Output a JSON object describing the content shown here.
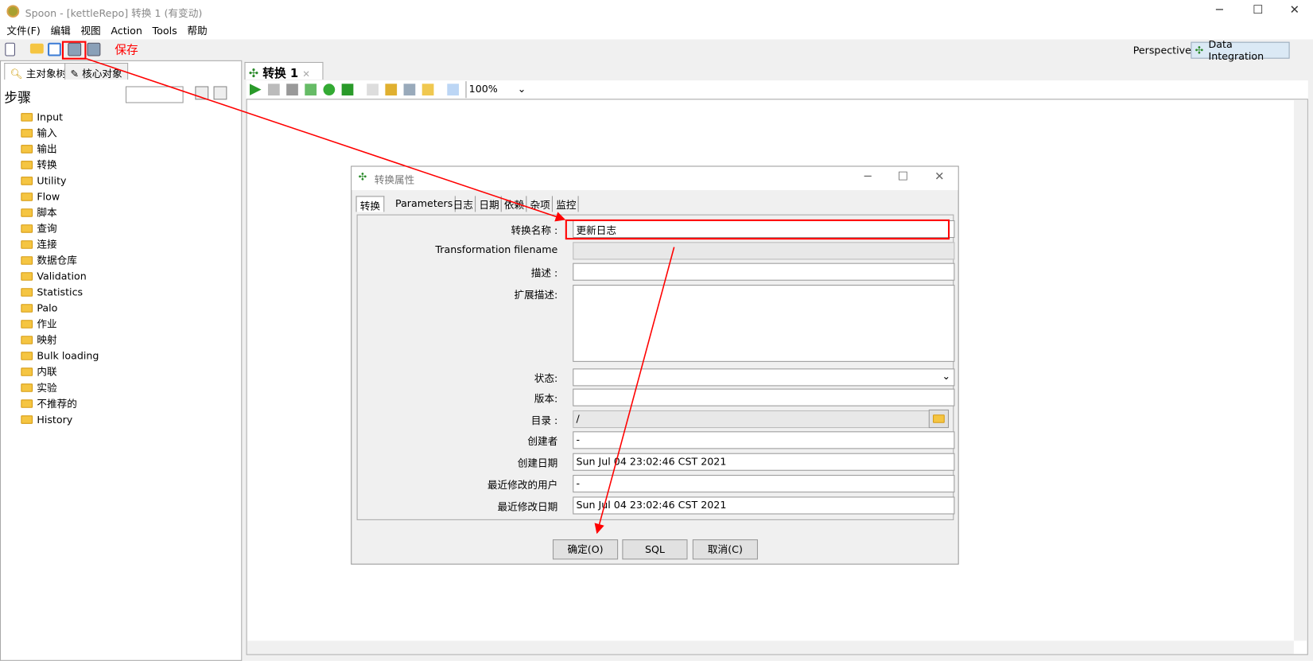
{
  "window": {
    "title": "Spoon - [kettleRepo] 转换 1 (有变动)"
  },
  "menu": [
    "文件(F)",
    "编辑",
    "视图",
    "Action",
    "Tools",
    "帮助"
  ],
  "annotation": {
    "save_label": "保存",
    "color": "#ff0000"
  },
  "perspective": {
    "label": "Perspective:",
    "value": "Data Integration"
  },
  "left_tabs": [
    "主对象树",
    "核心对象"
  ],
  "steps_label": "步骤",
  "steps": [
    "Input",
    "输入",
    "输出",
    "转换",
    "Utility",
    "Flow",
    "脚本",
    "查询",
    "连接",
    "数据仓库",
    "Validation",
    "Statistics",
    "Palo",
    "作业",
    "映射",
    "Bulk loading",
    "内联",
    "实验",
    "不推荐的",
    "History"
  ],
  "editor": {
    "tab": "转换 1",
    "zoom": "100%"
  },
  "dialog": {
    "title": "转换属性",
    "tabs": [
      "转换",
      "Parameters",
      "日志",
      "日期",
      "依赖",
      "杂项",
      "监控"
    ],
    "fields": {
      "name": {
        "label": "转换名称 :",
        "value": "更新日志"
      },
      "filename": {
        "label": "Transformation filename",
        "value": ""
      },
      "desc": {
        "label": "描述 :",
        "value": ""
      },
      "ext_desc": {
        "label": "扩展描述:",
        "value": ""
      },
      "status": {
        "label": "状态:",
        "value": ""
      },
      "version": {
        "label": "版本:",
        "value": ""
      },
      "directory": {
        "label": "目录 :",
        "value": "/"
      },
      "creator": {
        "label": "创建者",
        "value": "-"
      },
      "created": {
        "label": "创建日期",
        "value": "Sun Jul 04 23:02:46 CST 2021"
      },
      "modified_user": {
        "label": "最近修改的用户",
        "value": "-"
      },
      "modified_date": {
        "label": "最近修改日期",
        "value": "Sun Jul 04 23:02:46 CST 2021"
      }
    },
    "buttons": {
      "ok": "确定(O)",
      "sql": "SQL",
      "cancel": "取消(C)"
    }
  }
}
